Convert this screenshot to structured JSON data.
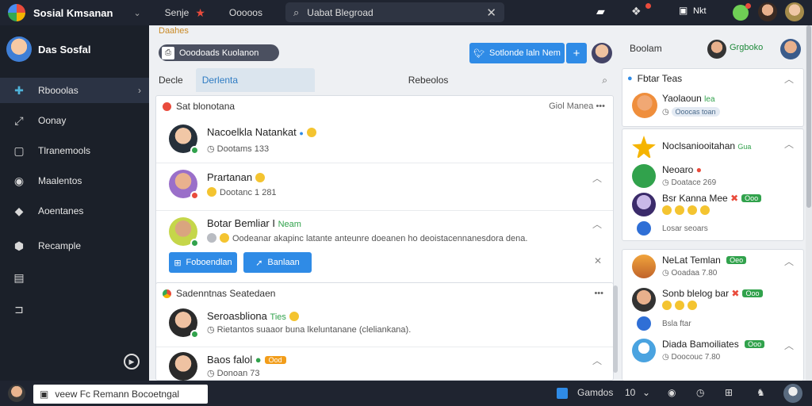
{
  "topbar": {
    "brand": "Sosial Kmsanan",
    "link1": "Senje",
    "link2": "Ooooos",
    "search_value": "Uabat Blegroad",
    "right_label": "Nkt"
  },
  "sidebar": {
    "user_name": "Das Sosfal",
    "items": [
      {
        "label": "Rbooolas",
        "icon": "people-icon",
        "glyph": "✚"
      },
      {
        "label": "Oonay",
        "icon": "expand-icon",
        "glyph": "⤢"
      },
      {
        "label": "Tlranemools",
        "icon": "document-icon",
        "glyph": "▢"
      },
      {
        "label": "Maalentos",
        "icon": "record-icon",
        "glyph": "◉"
      },
      {
        "label": "Aoentanes",
        "icon": "chat-icon",
        "glyph": "◆"
      },
      {
        "label": "Recample",
        "icon": "settings-icon",
        "glyph": "⬢"
      },
      {
        "label": "",
        "icon": "grid-icon",
        "glyph": "▤"
      },
      {
        "label": "",
        "icon": "link-icon",
        "glyph": "⊐"
      }
    ]
  },
  "main": {
    "section_title": "Daahes",
    "chip_label": "Ooodoads Kuolanon",
    "primary_button": "Sotlonde laln Nem",
    "plus_button": "+",
    "tabs": [
      "Decle",
      "Derlenta",
      "Rebeolos"
    ],
    "card1": {
      "title": "Sat blonotana",
      "right": "Giol Manea",
      "rows": [
        {
          "name": "Nacoelkla Natankat",
          "sub": "Dootams 133"
        },
        {
          "name": "Prartanan",
          "sub": "Dootanc 1 281"
        },
        {
          "name": "Botar Bemliar I",
          "tag": "Neam",
          "sub": "Oodeanar akapinc latante anteunre doeanen ho deoistacennanesdora dena."
        }
      ],
      "btn1": "Foboendlan",
      "btn2": "Banlaan"
    },
    "card2": {
      "title": "Sadenntnas Seatedaen",
      "rows": [
        {
          "name": "Seroasbliona",
          "tag": "Ties",
          "sub": "Rietantos suaaor buna lkeluntanane (cleliankana)."
        },
        {
          "name": "Baos falol",
          "badge": "Ood",
          "sub": "Donoan 73"
        }
      ]
    }
  },
  "right": {
    "label": "Boolam",
    "group": "Grgboko",
    "card1": {
      "title": "Fbtar Teas",
      "rows": [
        {
          "name": "Yaolaoun",
          "tag": "lea",
          "sub": "Ooocas toan"
        }
      ]
    },
    "card2": {
      "rows": [
        {
          "name": "Noclsaniooitahan",
          "tag": "Gua",
          "sub": ""
        },
        {
          "name": "Neoaro",
          "sub": "Doatace 269"
        },
        {
          "name": "Bsr Kanna Mee",
          "tag": "Ooo",
          "sub": ""
        },
        {
          "name": "",
          "sub": "Losar seoars"
        }
      ]
    },
    "card3": {
      "rows": [
        {
          "name": "NeLat Temlan",
          "tag": "Oeo",
          "sub": "Ooadaa 7.80"
        },
        {
          "name": "Sonb blelog bar",
          "tag": "Ooo",
          "sub": "Bsla ftar"
        },
        {
          "name": "Diada Bamoiliates",
          "tag": "Ooo",
          "sub": "Doocouc 7.80"
        }
      ]
    }
  },
  "bottombar": {
    "input_value": "veew Fc Remann  Bocoetngal",
    "right_label": "Gamdos",
    "count": "10"
  }
}
